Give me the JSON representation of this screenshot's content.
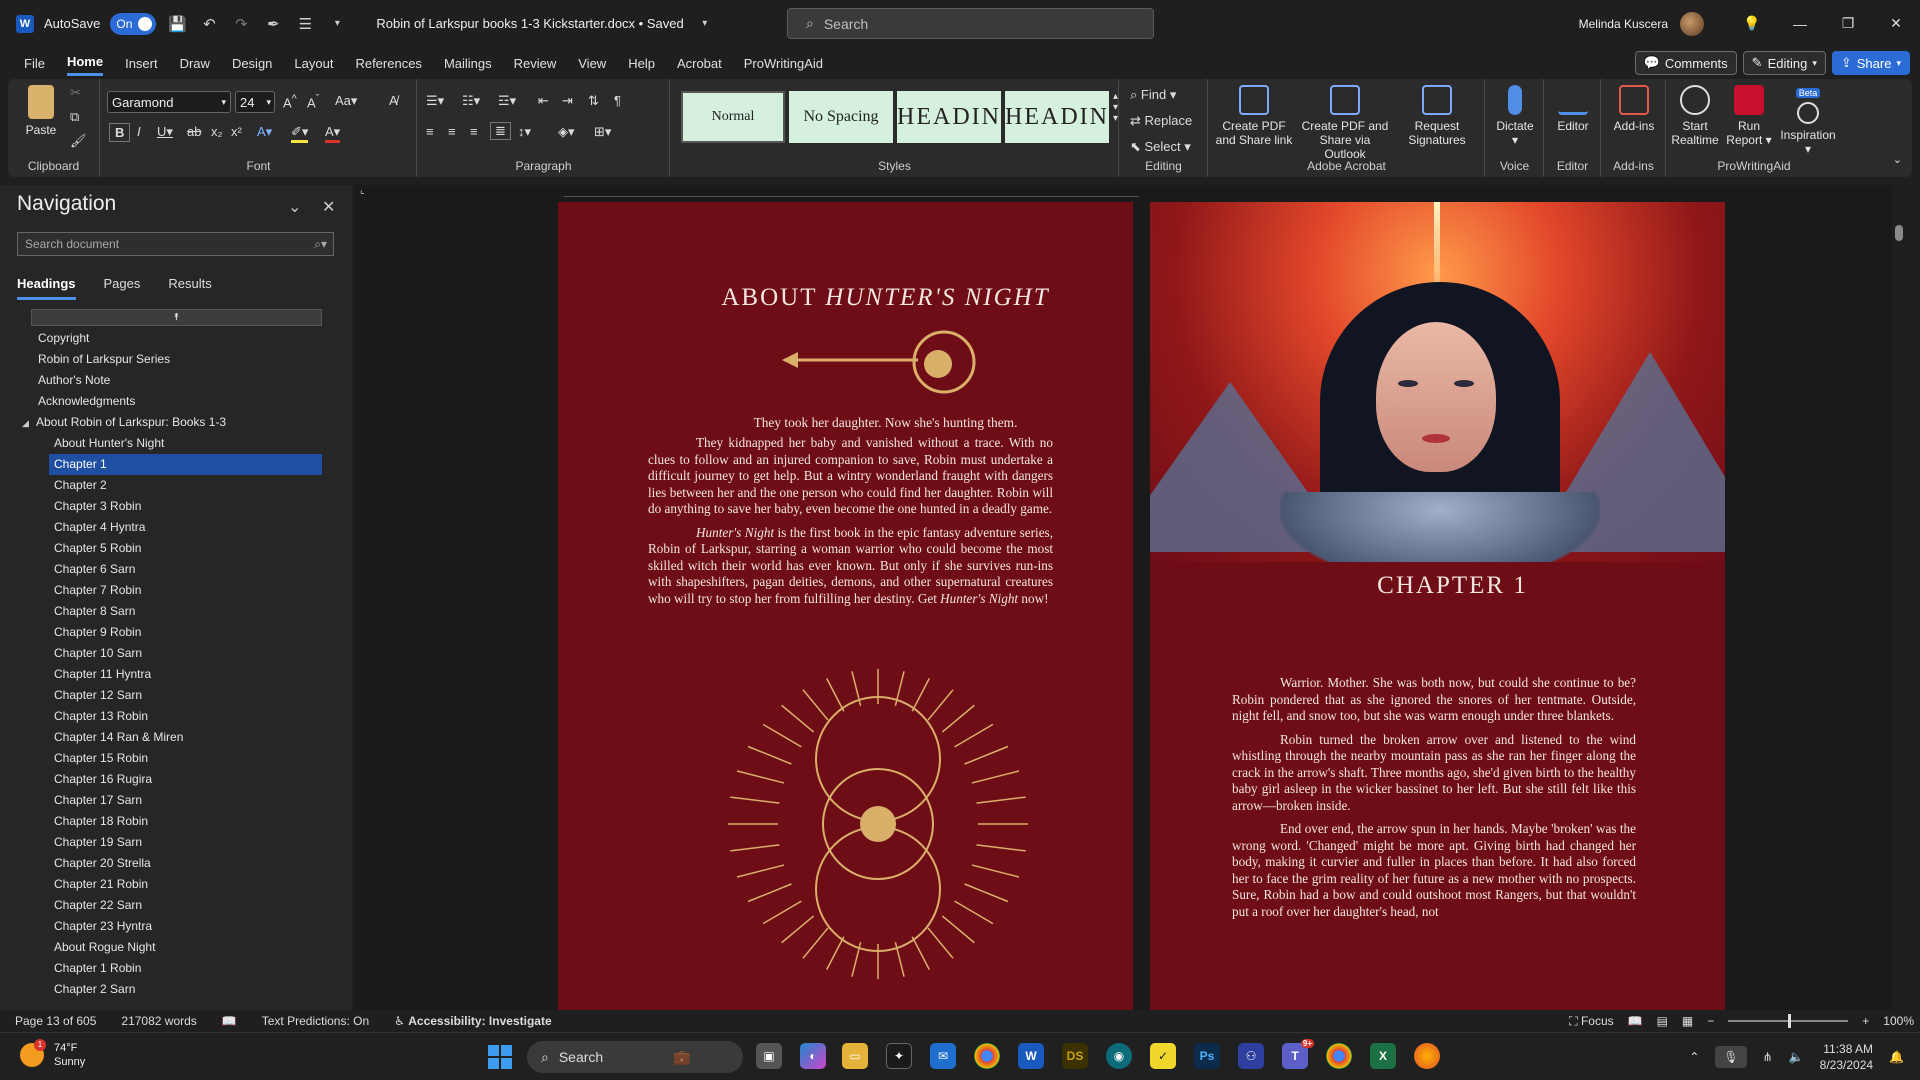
{
  "titlebar": {
    "app_icon": "W",
    "autosave_label": "AutoSave",
    "autosave_state": "On",
    "document_title": "Robin of Larkspur books 1-3  Kickstarter.docx • Saved",
    "search_placeholder": "Search",
    "user_name": "Melinda Kuscera"
  },
  "menu": {
    "items": [
      "File",
      "Home",
      "Insert",
      "Draw",
      "Design",
      "Layout",
      "References",
      "Mailings",
      "Review",
      "View",
      "Help",
      "Acrobat",
      "ProWritingAid"
    ],
    "active": "Home",
    "comments": "Comments",
    "editing": "Editing",
    "share": "Share"
  },
  "ribbon": {
    "clipboard": {
      "label": "Clipboard",
      "paste": "Paste"
    },
    "font": {
      "label": "Font",
      "family": "Garamond",
      "size": "24"
    },
    "paragraph": {
      "label": "Paragraph"
    },
    "styles": {
      "label": "Styles",
      "items": [
        "Normal",
        "No Spacing",
        "HEADIN",
        "HEADIN"
      ]
    },
    "editing": {
      "label": "Editing",
      "find": "Find",
      "replace": "Replace",
      "select": "Select"
    },
    "acrobat": {
      "label": "Adobe Acrobat",
      "create_pdf": "Create PDF and Share link",
      "create_pdf_outlook": "Create PDF and Share via Outlook",
      "request_signatures": "Request Signatures"
    },
    "voice": {
      "label": "Voice",
      "dictate": "Dictate"
    },
    "editor": {
      "label": "Editor",
      "editor": "Editor"
    },
    "addins": {
      "label": "Add-ins",
      "addins": "Add-ins"
    },
    "prowritingaid": {
      "label": "ProWritingAid",
      "start_realtime": "Start Realtime",
      "run_report": "Run Report",
      "inspiration": "Inspiration",
      "beta": "Beta"
    }
  },
  "navigation": {
    "title": "Navigation",
    "search_placeholder": "Search document",
    "tabs": [
      "Headings",
      "Pages",
      "Results"
    ],
    "active_tab": "Headings",
    "headings": [
      {
        "text": "Copyright",
        "level": 1
      },
      {
        "text": "Robin of Larkspur Series",
        "level": 1
      },
      {
        "text": "Author's Note",
        "level": 1
      },
      {
        "text": "Acknowledgments",
        "level": 1
      },
      {
        "text": "About Robin of Larkspur: Books 1-3",
        "level": 1,
        "expanded": true
      },
      {
        "text": "About Hunter's Night",
        "level": 2
      },
      {
        "text": "Chapter 1",
        "level": 2,
        "selected": true
      },
      {
        "text": "Chapter 2",
        "level": 2
      },
      {
        "text": "Chapter 3 Robin",
        "level": 2
      },
      {
        "text": "Chapter 4 Hyntra",
        "level": 2
      },
      {
        "text": "Chapter 5 Robin",
        "level": 2
      },
      {
        "text": "Chapter 6 Sarn",
        "level": 2
      },
      {
        "text": "Chapter 7 Robin",
        "level": 2
      },
      {
        "text": "Chapter 8 Sarn",
        "level": 2
      },
      {
        "text": "Chapter 9 Robin",
        "level": 2
      },
      {
        "text": "Chapter 10 Sarn",
        "level": 2
      },
      {
        "text": "Chapter 11 Hyntra",
        "level": 2
      },
      {
        "text": "Chapter 12 Sarn",
        "level": 2
      },
      {
        "text": "Chapter 13 Robin",
        "level": 2
      },
      {
        "text": "Chapter 14 Ran & Miren",
        "level": 2
      },
      {
        "text": "Chapter 15 Robin",
        "level": 2
      },
      {
        "text": "Chapter 16 Rugira",
        "level": 2
      },
      {
        "text": "Chapter 17 Sarn",
        "level": 2
      },
      {
        "text": "Chapter 18 Robin",
        "level": 2
      },
      {
        "text": "Chapter 19 Sarn",
        "level": 2
      },
      {
        "text": "Chapter 20 Strella",
        "level": 2
      },
      {
        "text": "Chapter 21 Robin",
        "level": 2
      },
      {
        "text": "Chapter 22 Sarn",
        "level": 2
      },
      {
        "text": "Chapter 23 Hyntra",
        "level": 2
      },
      {
        "text": "About Rogue Night",
        "level": 2
      },
      {
        "text": "Chapter 1 Robin",
        "level": 2
      },
      {
        "text": "Chapter 2 Sarn",
        "level": 2
      }
    ]
  },
  "page1": {
    "title_plain": "ABOUT ",
    "title_italic": "HUNTER'S NIGHT",
    "tagline": "They took her daughter. Now she's hunting them.",
    "para1": "They kidnapped her baby and vanished without a trace. With no clues to follow and an injured companion to save, Robin must undertake a difficult journey to get help. But a wintry wonderland fraught with dangers lies between her and the one person who could find her daughter. Robin will do anything to save her baby, even become the one hunted in a deadly game.",
    "para2_italic_start": "Hunter's Night",
    "para2_mid": " is the first book in the epic fantasy adventure series, Robin of Larkspur, starring a woman warrior who could become the most skilled witch their world has ever known. But only if she survives run-ins with shapeshifters, pagan deities, demons, and other supernatural creatures who will try to stop her from fulfilling her destiny. Get ",
    "para2_italic_end": "Hunter's Night",
    "para2_end": " now!"
  },
  "page2": {
    "chapter_title": "CHAPTER 1",
    "para1": "Warrior. Mother. She was both now, but could she continue to be? Robin pondered that as she ignored the snores of her tentmate. Outside, night fell, and snow too, but she was warm enough under three blankets.",
    "para2": "Robin turned the broken arrow over and listened to the wind whistling through the nearby mountain pass as she ran her finger along the crack in the arrow's shaft. Three months ago, she'd given birth to the healthy baby girl asleep in the wicker bassinet to her left. But she still felt like this arrow—broken inside.",
    "para3": "End over end, the arrow spun in her hands. Maybe 'broken' was the wrong word. 'Changed' might be more apt. Giving birth had changed her body, making it curvier and fuller in places than before. It had also forced her to face the grim reality of her future as a new mother with no prospects. Sure, Robin had a bow and could outshoot most Rangers, but that wouldn't put a roof over her daughter's head, not"
  },
  "status": {
    "page": "Page 13 of 605",
    "words": "217082 words",
    "text_predictions": "Text Predictions: On",
    "accessibility": "Accessibility: Investigate",
    "focus": "Focus",
    "zoom": "100%"
  },
  "taskbar": {
    "temperature": "74°F",
    "condition": "Sunny",
    "weather_badge": "1",
    "search_placeholder": "Search",
    "teams_badge": "9+",
    "time": "11:38 AM",
    "date": "8/23/2024"
  },
  "colors": {
    "accent": "#2b6bd6",
    "page_bg": "#6f0d17",
    "selection": "#1f4fa3",
    "style_card": "#d6f0de"
  }
}
